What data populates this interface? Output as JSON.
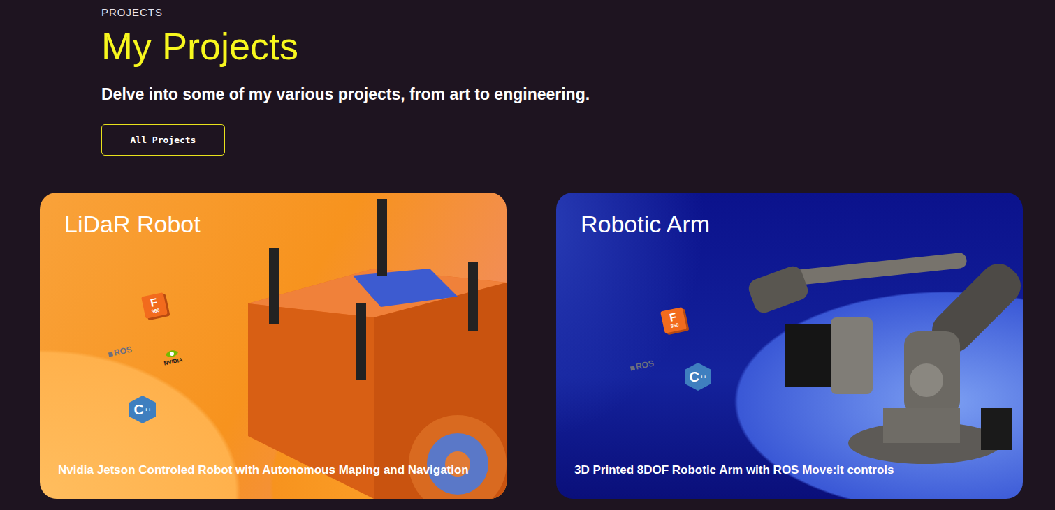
{
  "section_label": "PROJECTS",
  "title": "My Projects",
  "subtitle": "Delve into some of my various projects, from art to engineering.",
  "button": "All Projects",
  "cards": [
    {
      "title": "LiDaR Robot",
      "caption": "Nvidia Jetson Controled Robot with Autonomous Maping and Navigation",
      "kind": "robot",
      "color": "#f7931e",
      "tech": [
        {
          "kind": "fusion",
          "text": "F",
          "sub": "360"
        },
        {
          "kind": "ros",
          "text": "ROS"
        },
        {
          "kind": "nvidia",
          "text": "NVIDIA"
        },
        {
          "kind": "cpp",
          "text": "C",
          "sub": "++"
        }
      ]
    },
    {
      "title": "Robotic Arm",
      "caption": "3D Printed 8DOF Robotic Arm with ROS Move:it controls",
      "kind": "arm",
      "color": "#0b128c",
      "tech": [
        {
          "kind": "fusion",
          "text": "F",
          "sub": "360"
        },
        {
          "kind": "ros",
          "text": "ROS"
        },
        {
          "kind": "cpp",
          "text": "C",
          "sub": "++"
        }
      ]
    }
  ]
}
